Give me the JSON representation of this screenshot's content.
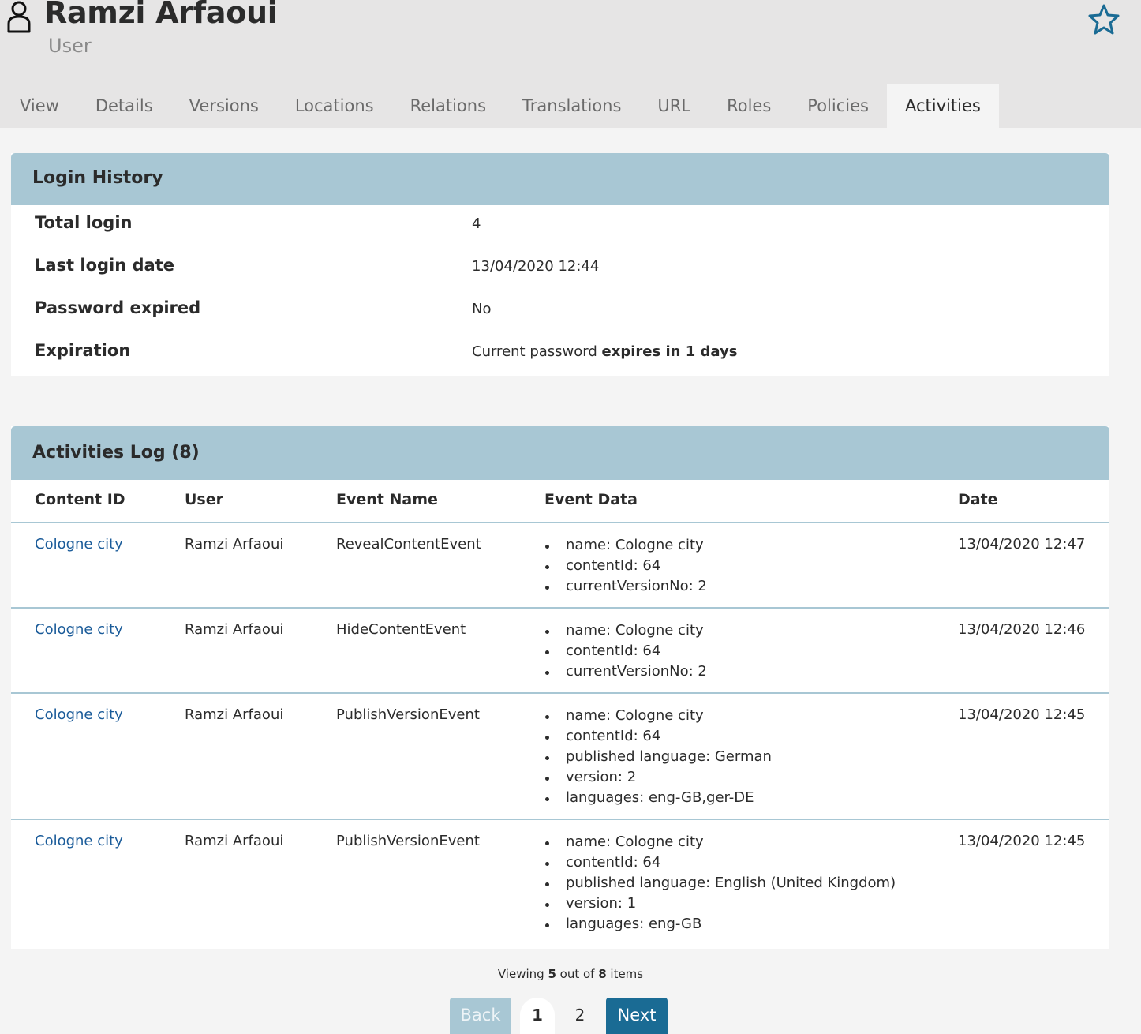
{
  "header": {
    "title": "Ramzi Arfaoui",
    "subtitle": "User",
    "user_icon": "user-icon",
    "favorite_icon": "star-icon"
  },
  "tabs": [
    "View",
    "Details",
    "Versions",
    "Locations",
    "Relations",
    "Translations",
    "URL",
    "Roles",
    "Policies",
    "Activities"
  ],
  "active_tab": "Activities",
  "login_history": {
    "title": "Login History",
    "rows": [
      {
        "label": "Total login",
        "value": "4"
      },
      {
        "label": "Last login date",
        "value": "13/04/2020 12:44"
      },
      {
        "label": "Password expired",
        "value": "No"
      }
    ],
    "expiration": {
      "label": "Expiration",
      "prefix": "Current password ",
      "emphasis": "expires in 1 days"
    }
  },
  "activities_log": {
    "title": "Activities Log (8)",
    "columns": [
      "Content ID",
      "User",
      "Event Name",
      "Event Data",
      "Date"
    ],
    "rows": [
      {
        "content_id": "Cologne city",
        "user": "Ramzi Arfaoui",
        "event": "RevealContentEvent",
        "data": [
          "name: Cologne city",
          "contentId: 64",
          "currentVersionNo: 2"
        ],
        "date": "13/04/2020 12:47"
      },
      {
        "content_id": "Cologne city",
        "user": "Ramzi Arfaoui",
        "event": "HideContentEvent",
        "data": [
          "name: Cologne city",
          "contentId: 64",
          "currentVersionNo: 2"
        ],
        "date": "13/04/2020 12:46"
      },
      {
        "content_id": "Cologne city",
        "user": "Ramzi Arfaoui",
        "event": "PublishVersionEvent",
        "data": [
          "name: Cologne city",
          "contentId: 64",
          "published language: German",
          "version: 2",
          "languages: eng-GB,ger-DE"
        ],
        "date": "13/04/2020 12:45"
      },
      {
        "content_id": "Cologne city",
        "user": "Ramzi Arfaoui",
        "event": "PublishVersionEvent",
        "data": [
          "name: Cologne city",
          "contentId: 64",
          "published language: English (United Kingdom)",
          "version: 1",
          "languages: eng-GB"
        ],
        "date": "13/04/2020 12:45"
      }
    ]
  },
  "pagination": {
    "viewing_prefix": "Viewing ",
    "shown": "5",
    "middle": " out of ",
    "total": "8",
    "suffix": " items",
    "back_label": "Back",
    "pages": [
      "1",
      "2"
    ],
    "current_page": "1",
    "next_label": "Next"
  },
  "colors": {
    "header_bg": "#e6e5e5",
    "panel_head": "#a8c7d4",
    "link": "#1a5b99",
    "primary_button": "#1a6b94",
    "star": "#1a6b94"
  }
}
